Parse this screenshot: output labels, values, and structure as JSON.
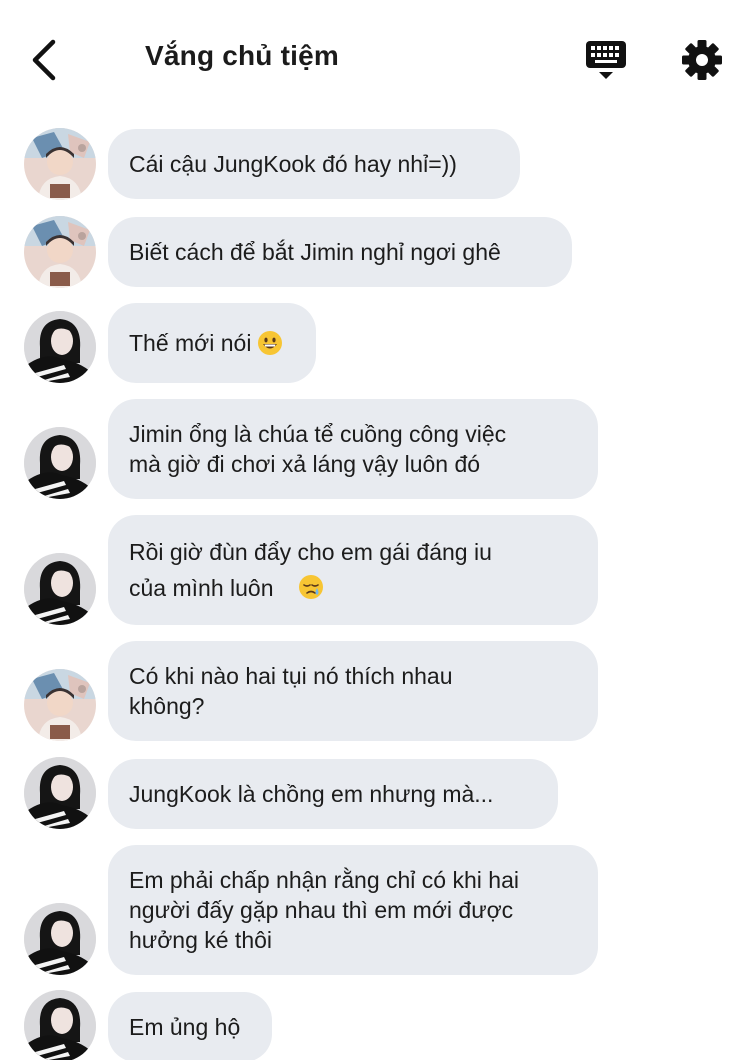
{
  "header": {
    "title": "Vắng chủ tiệm",
    "back_icon": "chevron-left-icon",
    "keyboard_icon": "keyboard-icon",
    "settings_icon": "gear-icon"
  },
  "colors": {
    "bubble": "#e8ebf0",
    "text": "#1c1c1c",
    "background": "#ffffff"
  },
  "messages": [
    {
      "sender": "a",
      "text": "Cái cậu JungKook đó hay nhỉ=))"
    },
    {
      "sender": "a",
      "text": "Biết cách để bắt Jimin nghỉ ngơi ghê"
    },
    {
      "sender": "b",
      "text": "Thế mới nói",
      "emoji": "grinning-face-emoji"
    },
    {
      "sender": "b",
      "text": "Jimin ổng là chúa tể cuồng công việc\nmà giờ đi chơi xả láng vậy luôn đó"
    },
    {
      "sender": "b",
      "text": "Rồi giờ đùn đẩy cho em gái đáng iu\ncủa mình luôn",
      "emoji": "sleepy-face-emoji"
    },
    {
      "sender": "a",
      "text": "Có khi nào hai tụi nó thích nhau\nkhông?"
    },
    {
      "sender": "b",
      "text": "JungKook là chồng em nhưng mà..."
    },
    {
      "sender": "b",
      "text": "Em phải chấp nhận rằng chỉ có khi hai\nngười đấy gặp nhau thì em mới được\nhưởng ké thôi"
    },
    {
      "sender": "b",
      "text": "Em ủng hộ"
    }
  ]
}
